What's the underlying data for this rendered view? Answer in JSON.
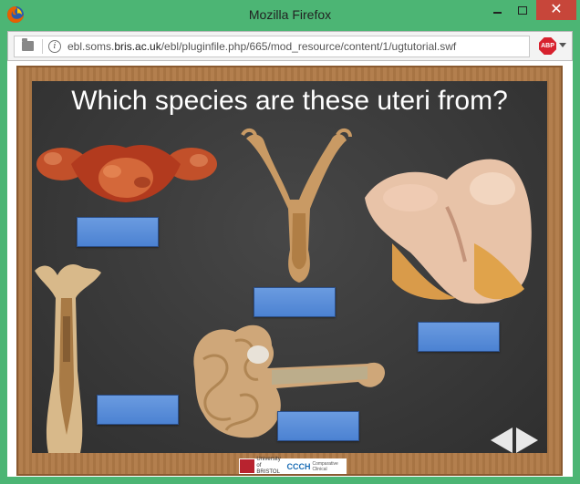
{
  "window": {
    "title": "Mozilla Firefox",
    "close_glyph": "✕"
  },
  "address_bar": {
    "url_prefix": "ebl.soms.",
    "url_domain": "bris.ac.uk",
    "url_path": "/ebl/pluginfile.php/665/mod_resource/content/1/ugtutorial.swf",
    "info_glyph": "i",
    "addon_label": "ABP"
  },
  "slide": {
    "question": "Which species are these uteri from?",
    "answer_boxes": [
      "",
      "",
      "",
      "",
      "",
      ""
    ],
    "logos": {
      "left_text": "University of BRISTOL",
      "right_text": "CCCH",
      "right_sub": "Comparative Clinical"
    }
  },
  "colors": {
    "titlebar": "#4cb574",
    "board": "#3b3b3b",
    "frame": "#b07a47",
    "answer_box": "#5b8fd8"
  }
}
